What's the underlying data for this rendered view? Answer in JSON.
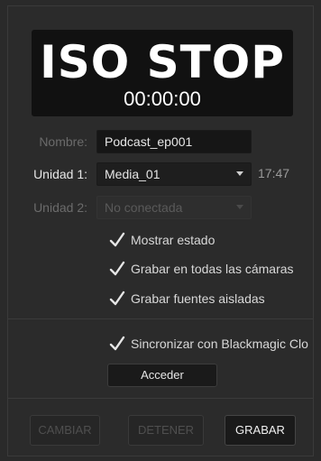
{
  "display": {
    "title": "ISO STOP",
    "timecode": "00:00:00"
  },
  "form": {
    "name_label": "Nombre:",
    "name_value": "Podcast_ep001",
    "unit1_label": "Unidad 1:",
    "unit1_value": "Media_01",
    "unit1_remaining": "17:47",
    "unit2_label": "Unidad 2:",
    "unit2_value": "No conectada"
  },
  "options": {
    "show_status": "Mostrar estado",
    "record_all_cameras": "Grabar en todas las cámaras",
    "record_iso_sources": "Grabar fuentes aisladas",
    "sync_blackmagic": "Sincronizar con Blackmagic Clo"
  },
  "buttons": {
    "access": "Acceder",
    "change": "CAMBIAR",
    "stop": "DETENER",
    "record": "GRABAR"
  },
  "icons": {
    "checkmark": "checkmark-icon",
    "caret": "chevron-down-icon"
  },
  "colors": {
    "background": "#2b2b2b",
    "display_bg": "#111111",
    "text": "#e6e6e6",
    "muted": "#6b6b6b"
  }
}
